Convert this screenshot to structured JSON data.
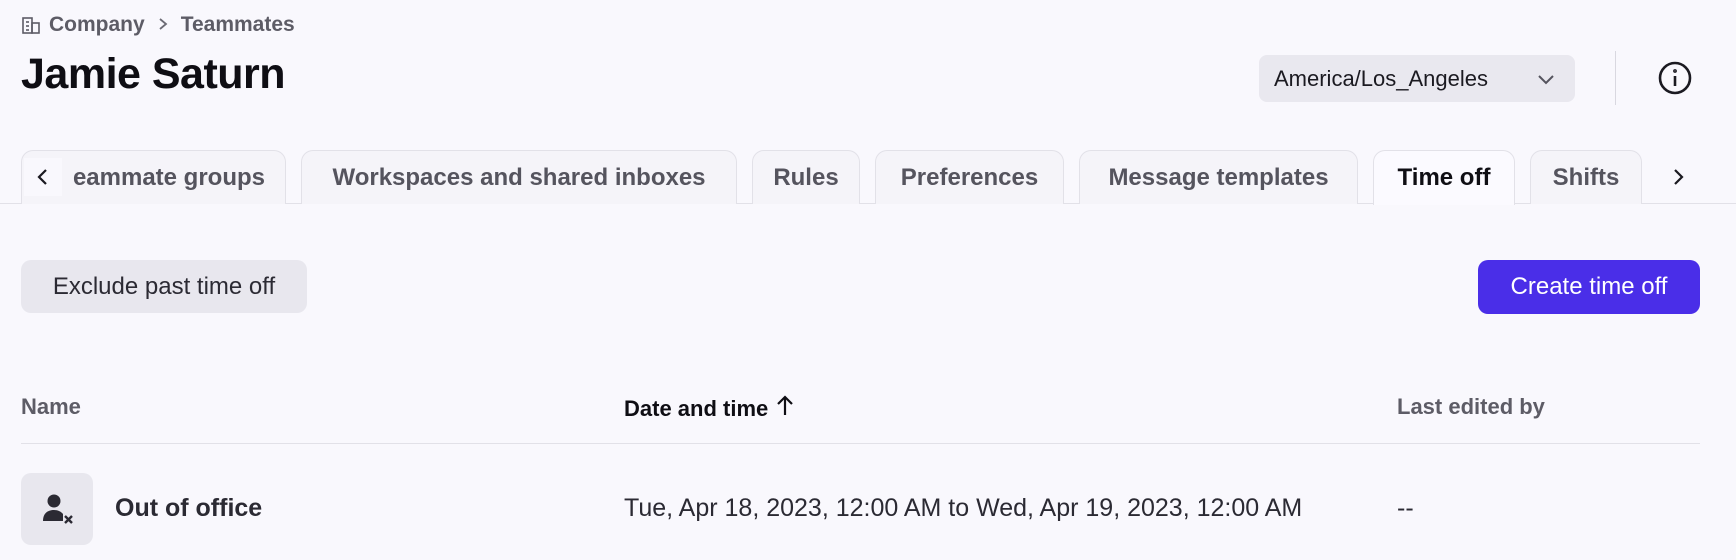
{
  "breadcrumb": {
    "items": [
      "Company",
      "Teammates"
    ],
    "icon": "building-icon"
  },
  "page": {
    "title": "Jamie Saturn"
  },
  "header": {
    "timezone": "America/Los_Angeles"
  },
  "tabs": [
    {
      "label": "eammate groups",
      "active": false
    },
    {
      "label": "Workspaces and shared inboxes",
      "active": false
    },
    {
      "label": "Rules",
      "active": false
    },
    {
      "label": "Preferences",
      "active": false
    },
    {
      "label": "Message templates",
      "active": false
    },
    {
      "label": "Time off",
      "active": true
    },
    {
      "label": "Shifts",
      "active": false
    }
  ],
  "toolbar": {
    "filter_label": "Exclude past time off",
    "create_label": "Create time off"
  },
  "table": {
    "columns": [
      "Name",
      "Date and time",
      "Last edited by"
    ],
    "sorted_column": "Date and time",
    "sort_direction": "ascending",
    "rows": [
      {
        "icon": "user-off-icon",
        "name": "Out of office",
        "date_time": "Tue, Apr 18, 2023, 12:00 AM to Wed, Apr 19, 2023, 12:00 AM",
        "last_edited_by": "--"
      }
    ]
  },
  "colors": {
    "accent": "#4a2ee8",
    "background": "#f9f8fd"
  }
}
